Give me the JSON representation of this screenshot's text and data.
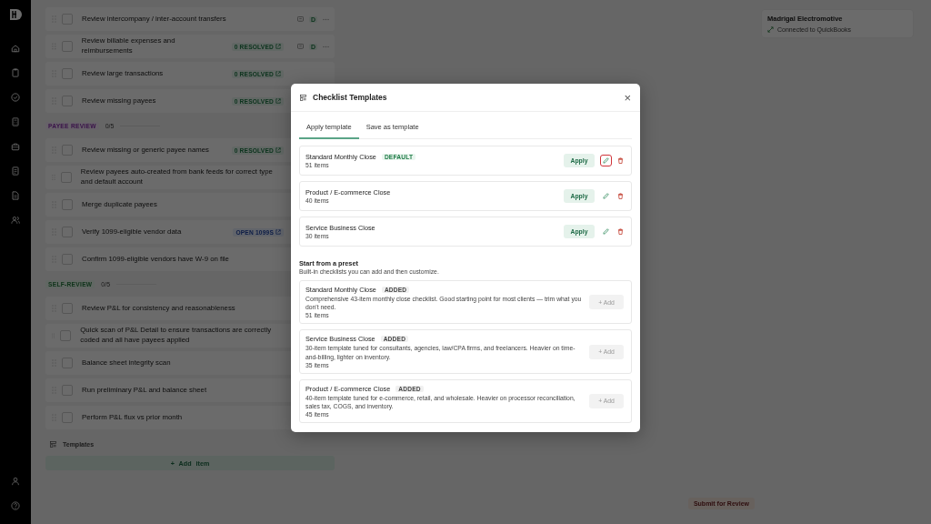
{
  "checklist": {
    "sections": [
      {
        "items": [
          {
            "text": "Review intercompany / inter-account transfers",
            "checked": false,
            "assignee": "D"
          },
          {
            "text": "Review billable expenses and reimbursements",
            "checked": false,
            "badge": {
              "text": "0 RESOLVED",
              "kind": "resolved"
            },
            "assignee": "D"
          },
          {
            "text": "Review large transactions",
            "checked": false,
            "badge": {
              "text": "0 RESOLVED",
              "kind": "resolved"
            }
          },
          {
            "text": "Review missing payees",
            "checked": false,
            "badge": {
              "text": "0 RESOLVED",
              "kind": "resolved"
            }
          }
        ]
      },
      {
        "label": "PAYEE REVIEW",
        "kind": "payee",
        "progress": "0/5",
        "level": 0,
        "items": [
          {
            "text": "Review missing or generic payee names",
            "checked": false,
            "badge": {
              "text": "0 RESOLVED",
              "kind": "resolved"
            }
          },
          {
            "text": "Review payees auto-created from bank feeds for correct type and default account",
            "checked": false
          },
          {
            "text": "Merge duplicate payees",
            "checked": false
          },
          {
            "text": "Verify 1099-eligible vendor data",
            "checked": false,
            "badge": {
              "text": "OPEN 1099S",
              "kind": "open"
            }
          },
          {
            "text": "Confirm 1099-eligible vendors have W-9 on file",
            "checked": false
          }
        ]
      },
      {
        "label": "SELF-REVIEW",
        "kind": "self",
        "progress": "0/5",
        "level": 0,
        "items": [
          {
            "text": "Review P&L for consistency and reasonableness",
            "checked": false
          },
          {
            "text": "Quick scan of P&L Detail to ensure transactions are correctly coded and all have payees applied",
            "checked": false
          },
          {
            "text": "Balance sheet integrity scan",
            "checked": false
          },
          {
            "text": "Run preliminary P&L and balance sheet",
            "checked": false
          },
          {
            "text": "Perform P&L flux vs prior month",
            "checked": false
          }
        ]
      }
    ],
    "templates_link": "Templates",
    "add_button": "+ Add item"
  },
  "company": {
    "name": "Madrigal Electromotive",
    "status": "Connected to QuickBooks"
  },
  "submit_button": "Submit for Review",
  "modal": {
    "title": "Checklist Templates",
    "close": "×",
    "tabs": [
      {
        "label": "Apply template",
        "selected": true
      },
      {
        "label": "Save as template",
        "selected": false
      }
    ],
    "templates": [
      {
        "name": "Standard Monthly Close",
        "badge": "DEFAULT",
        "count": "51 items",
        "action": "Apply",
        "edit_focused": true
      },
      {
        "name": "Product / E-commerce Close",
        "count": "40 items",
        "action": "Apply",
        "edit_focused": false
      },
      {
        "name": "Service Business Close",
        "count": "30 items",
        "action": "Apply",
        "edit_focused": false
      }
    ],
    "preset_heading": "Start from a preset",
    "preset_subtitle": "Built-in checklists you can add and then customize.",
    "presets": [
      {
        "name": "Standard Monthly Close",
        "badge": "ADDED",
        "description": "Comprehensive 43-item monthly close checklist. Good starting point for most clients — trim what you don't need.",
        "count": "51 items",
        "action": "+ Add",
        "disabled": true
      },
      {
        "name": "Service Business Close",
        "badge": "ADDED",
        "description": "30-item template tuned for consultants, agencies, law/CPA firms, and freelancers. Heavier on time-and-billing, lighter on inventory.",
        "count": "35 items",
        "action": "+ Add",
        "disabled": true
      },
      {
        "name": "Product / E-commerce Close",
        "badge": "ADDED",
        "description": "40-item template tuned for e-commerce, retail, and wholesale. Heavier on processor reconciliation, sales tax, COGS, and inventory.",
        "count": "45 items",
        "action": "+ Add",
        "disabled": true
      }
    ]
  }
}
